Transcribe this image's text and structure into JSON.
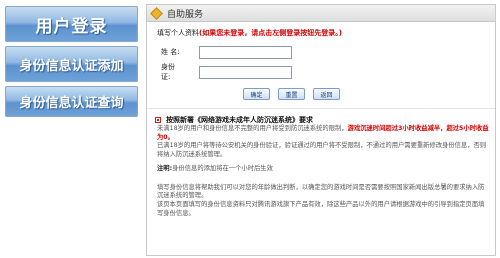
{
  "sidebar": {
    "login_label": "用户登录",
    "add_label": "身份信息认证添加",
    "query_label": "身份信息认证查询"
  },
  "panel": {
    "title": "自助服务",
    "notice_prefix": "填写个人资料",
    "notice_red": "(如果您未登录，请点击左侧登录按钮先登录。)"
  },
  "form": {
    "name_label": "姓  名:",
    "id_label": "身份证:",
    "name_value": "",
    "id_value": "",
    "confirm_label": "确定",
    "reset_label": "重置",
    "back_label": "返回"
  },
  "section": {
    "title": "按照新署《网络游戏未成年人防沉迷系统》要求",
    "p1_a": "未满18岁的用户和身份信息不完整的用户将受到防沉迷系统的限制，",
    "p1_red": "游戏沉迷时间超过3小时收益减半，超过5小时收益为0。",
    "p2": "已满18岁的用户将等待公安机关的身份验证，验证通过的用户将不受限制，不通过的用户需要重新修改身份信息，否则将纳入防沉迷系统管理。",
    "note_label": "注明:",
    "note_text": "身份信息的添加将在一个小时后生效",
    "p3": "填写身份信息将帮助我们可以对您的年龄做出判断，以确定您的游戏时间是否需要按照国家新闻出版总署的要求纳入防沉迷系统的管理。",
    "p4": "该页本页面填写的身份信息资料只对腾讯游戏旗下产品有效，除这些产品以外的用户请根据游戏中的引导到指定页面填写身份信息。"
  }
}
